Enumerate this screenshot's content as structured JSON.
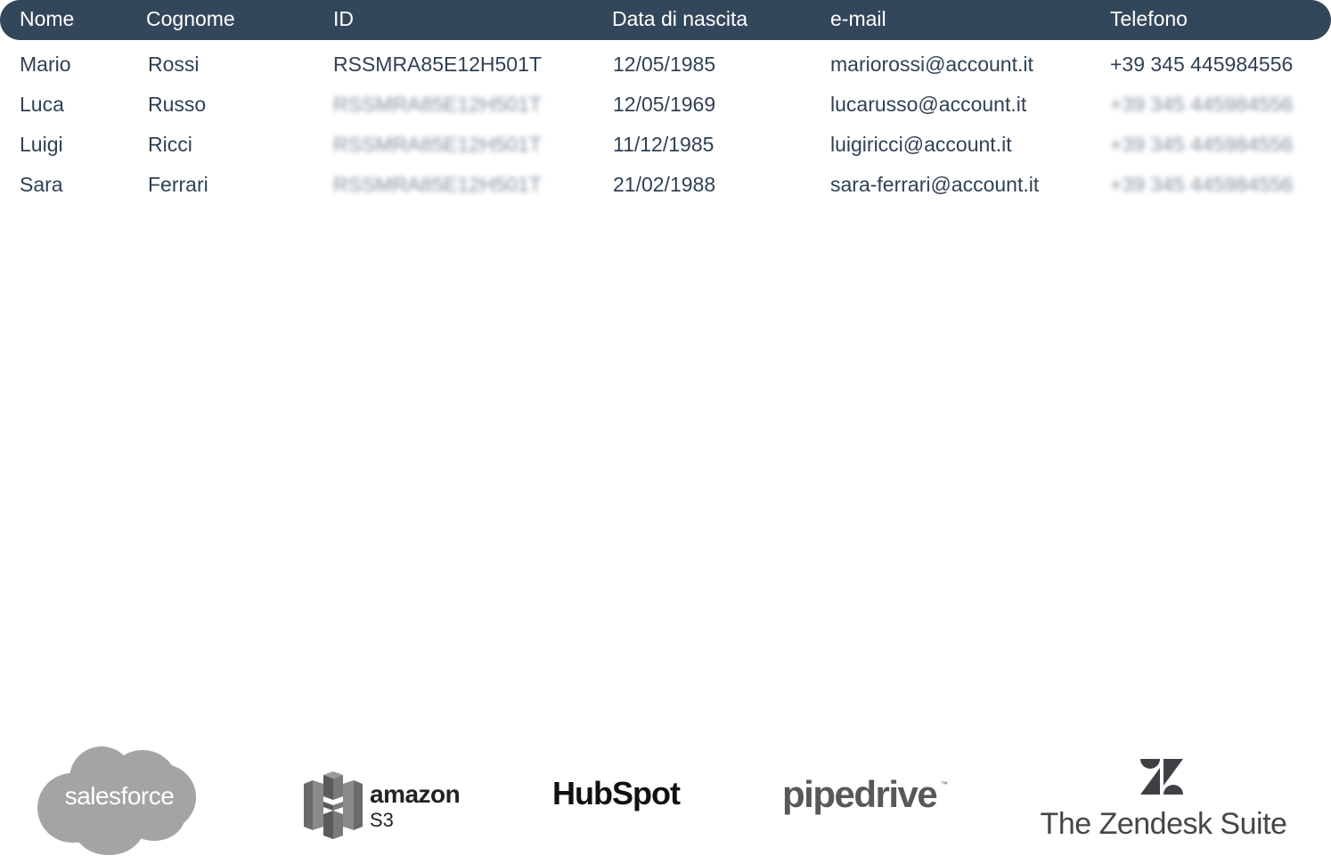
{
  "table": {
    "headers": [
      "Nome",
      "Cognome",
      "ID",
      "Data di nascita",
      "e-mail",
      "Telefono"
    ],
    "rows": [
      {
        "nome": "Mario",
        "cognome": "Rossi",
        "id": "RSSMRA85E12H501T",
        "data_nascita": "12/05/1985",
        "email": "mariorossi@account.it",
        "telefono": "+39 345 445984556"
      },
      {
        "nome": "Luca",
        "cognome": "Russo",
        "id": "RSSMRA85E12H501T",
        "data_nascita": "12/05/1969",
        "email": "lucarusso@account.it",
        "telefono": "+39 345 445984556"
      },
      {
        "nome": "Luigi",
        "cognome": "Ricci",
        "id": "RSSMRA85E12H501T",
        "data_nascita": "11/12/1985",
        "email": "luigiricci@account.it",
        "telefono": "+39 345 445984556"
      },
      {
        "nome": "Sara",
        "cognome": "Ferrari",
        "id": "RSSMRA85E12H501T",
        "data_nascita": "21/02/1988",
        "email": "sara-ferrari@account.it",
        "telefono": "+39 345 445984556"
      }
    ]
  },
  "logos": {
    "salesforce": "salesforce",
    "amazon_word": "amazon",
    "amazon_product": "S3",
    "hubspot": "HubSpot",
    "pipedrive": "pipedrive",
    "pipedrive_tm": "™",
    "zendesk": "The Zendesk Suite"
  },
  "colors": {
    "header_bg": "#33475b",
    "header_text": "#ffffff",
    "body_text": "#2f4155"
  }
}
